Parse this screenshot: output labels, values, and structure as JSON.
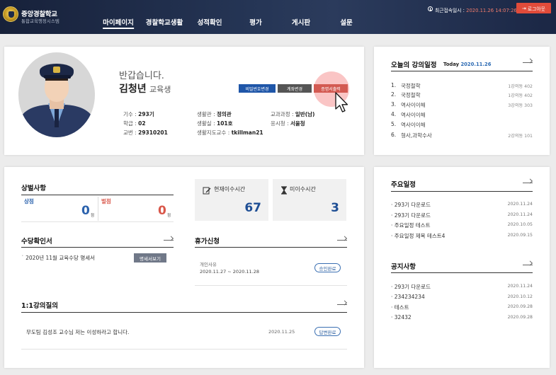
{
  "header": {
    "brand_title": "중앙경찰학교",
    "brand_subtitle": "통합교육행정시스템",
    "nav": [
      {
        "label": "마이페이지",
        "active": true
      },
      {
        "label": "경찰학교생활",
        "active": false
      },
      {
        "label": "성적확인",
        "active": false
      },
      {
        "label": "평가",
        "active": false
      },
      {
        "label": "게시판",
        "active": false
      },
      {
        "label": "설문",
        "active": false
      }
    ],
    "last_login_label": "최근접속일시 : ",
    "last_login_value": "2020.11.26 14:07:26",
    "logout_label": "로그아웃"
  },
  "profile": {
    "greeting": "반갑습니다.",
    "name": "김청년",
    "role": "교육생",
    "buttons": {
      "password": "비밀번호변경",
      "account": "계좌변경",
      "certificate": "증명서출력"
    },
    "info": [
      {
        "label": "기수 : ",
        "value": "293기"
      },
      {
        "label": "학급 : ",
        "value": "02"
      },
      {
        "label": "교번 : ",
        "value": "29310201"
      },
      {
        "label": "생활관 : ",
        "value": "정의관"
      },
      {
        "label": "생활실 : ",
        "value": "101호"
      },
      {
        "label": "생활지도교수 : ",
        "value": "tkillman21"
      },
      {
        "label": "교과과정 : ",
        "value": "일반(남)"
      },
      {
        "label": "응시청 : ",
        "value": "서울청"
      }
    ]
  },
  "lecture": {
    "title": "오늘의 강의일정",
    "today_label": "Today ",
    "today_date": "2020.11.26",
    "items": [
      {
        "num": "1.",
        "name": "국정철학",
        "room": "1강의동 402"
      },
      {
        "num": "2.",
        "name": "국정철학",
        "room": "1강의동 402"
      },
      {
        "num": "3.",
        "name": "역사이이해",
        "room": "3강의동 303"
      },
      {
        "num": "4.",
        "name": "역사이이해",
        "room": ""
      },
      {
        "num": "5.",
        "name": "역사이이해",
        "room": ""
      },
      {
        "num": "6.",
        "name": "형사,과학수사",
        "room": "2강의동 101"
      }
    ]
  },
  "merit": {
    "title": "상벌사항",
    "reward_label": "상점",
    "reward_value": "0",
    "penalty_label": "벌점",
    "penalty_value": "0",
    "unit": "점",
    "reward_color": "#2b62ad",
    "penalty_color": "#d9574a"
  },
  "stats": {
    "completed_label": "현재이수시간",
    "completed_value": "67",
    "incomplete_label": "미이수시간",
    "incomplete_value": "3"
  },
  "allowance": {
    "title": "수당확인서",
    "item": "2020년 11월 교육수당 명세서",
    "button": "명세서보기"
  },
  "leave": {
    "title": "휴가신청",
    "reason": "개인사유",
    "period": "2020.11.27 ~ 2020.11.28",
    "status": "승인완료"
  },
  "qna": {
    "title": "1:1강의질의",
    "item": "무도팀 김성조 교수님 저는 이성하라고 합니다.",
    "date": "2020.11.25",
    "status": "답변완료"
  },
  "schedule": {
    "title": "주요일정",
    "items": [
      {
        "text": "293기 다운로드",
        "date": "2020.11.24"
      },
      {
        "text": "293기 다운로드",
        "date": "2020.11.24"
      },
      {
        "text": "주요일정 테스트",
        "date": "2020.10.05"
      },
      {
        "text": "주요일정 제목 테스트4",
        "date": "2020.09.15"
      }
    ]
  },
  "notice": {
    "title": "공지사항",
    "items": [
      {
        "text": "293기 다운로드",
        "date": "2020.11.24"
      },
      {
        "text": "234234234",
        "date": "2020.10.12"
      },
      {
        "text": "테스트",
        "date": "2020.09.28"
      },
      {
        "text": "32432",
        "date": "2020.09.28"
      }
    ]
  }
}
